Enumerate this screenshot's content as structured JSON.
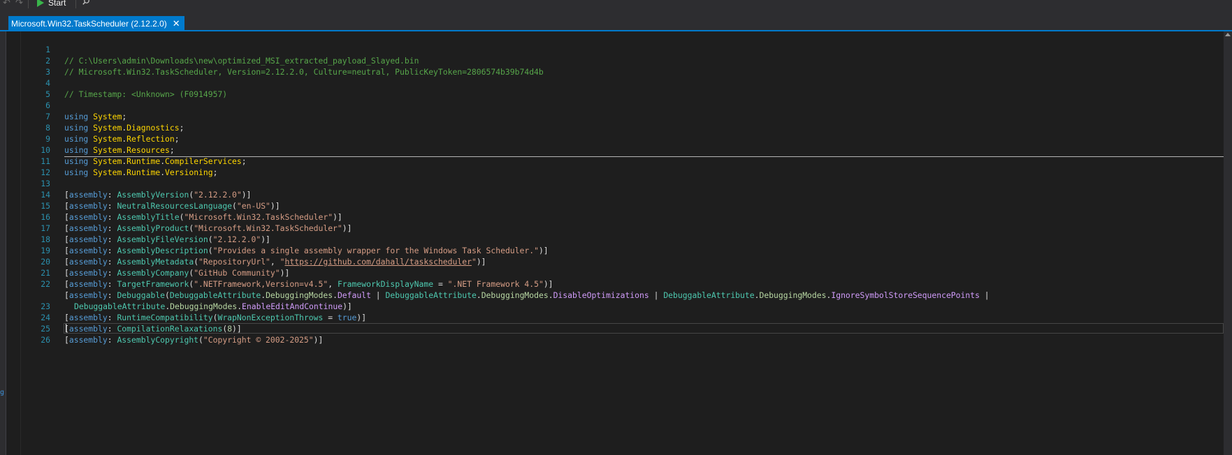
{
  "toolbar": {
    "start_label": "Start",
    "icons": [
      "undo-icon",
      "redo-icon",
      "play-icon",
      "search-icon"
    ]
  },
  "tab": {
    "title": "Microsoft.Win32.TaskScheduler (2.12.2.0)",
    "close_glyph": "✕"
  },
  "side": {
    "glyph": "g"
  },
  "colors": {
    "accent": "#007acc",
    "editor_bg": "#1e1e1e",
    "comment": "#57a64a",
    "keyword": "#569cd6",
    "namespace": "#ffd700",
    "type": "#4ec9b0",
    "string": "#d69d85",
    "line_number": "#2b91af"
  },
  "editor": {
    "line_numbers": [
      "1",
      "2",
      "3",
      "4",
      "5",
      "6",
      "7",
      "8",
      "9",
      "10",
      "11",
      "12",
      "13",
      "14",
      "15",
      "16",
      "17",
      "18",
      "19",
      "20",
      "21",
      "22",
      "23",
      "24",
      "25",
      "26"
    ],
    "l1": "// C:\\Users\\admin\\Downloads\\new\\optimized_MSI_extracted_payload_Slayed.bin",
    "l2": "// Microsoft.Win32.TaskScheduler, Version=2.12.2.0, Culture=neutral, PublicKeyToken=2806574b39b74d4b",
    "l4": "// Timestamp: <Unknown> (F0914957)",
    "kw_using": "using",
    "kw_assembly": "assembly",
    "kw_true": "true",
    "ns6": "System",
    "ns7a": "System",
    "ns7b": "Diagnostics",
    "ns8a": "System",
    "ns8b": "Reflection",
    "ns9a": "System",
    "ns9b": "Resources",
    "ns10a": "System",
    "ns10b": "Runtime",
    "ns10c": "CompilerServices",
    "ns11a": "System",
    "ns11b": "Runtime",
    "ns11c": "Versioning",
    "a13": "AssemblyVersion",
    "s13": "\"2.12.2.0\"",
    "a14": "NeutralResourcesLanguage",
    "s14": "\"en-US\"",
    "a15": "AssemblyTitle",
    "s15": "\"Microsoft.Win32.TaskScheduler\"",
    "a16": "AssemblyProduct",
    "s16": "\"Microsoft.Win32.TaskScheduler\"",
    "a17": "AssemblyFileVersion",
    "s17": "\"2.12.2.0\"",
    "a18": "AssemblyDescription",
    "s18": "\"Provides a single assembly wrapper for the Windows Task Scheduler.\"",
    "a19": "AssemblyMetadata",
    "s19a": "\"RepositoryUrl\"",
    "s19b_q": "\"",
    "s19b_url": "https://github.com/dahall/taskscheduler",
    "s19b_q2": "\"",
    "a20": "AssemblyCompany",
    "s20": "\"GitHub Community\"",
    "a21": "TargetFramework",
    "s21a": "\".NETFramework,Version=v4.5\"",
    "p21": "FrameworkDisplayName",
    "s21b": "\".NET Framework 4.5\"",
    "a22": "Debuggable",
    "t22": "DebuggableAttribute",
    "m22": "DebuggingModes",
    "e22a": "Default",
    "e22b": "DisableOptimizations",
    "e22c": "IgnoreSymbolStoreSequencePoints",
    "e22d": "EnableEditAndContinue",
    "a23": "RuntimeCompatibility",
    "p23": "WrapNonExceptionThrows",
    "a24": "CompilationRelaxations",
    "n24": "8",
    "a25": "AssemblyCopyright",
    "s25": "\"Copyright © 2002-2025\""
  }
}
